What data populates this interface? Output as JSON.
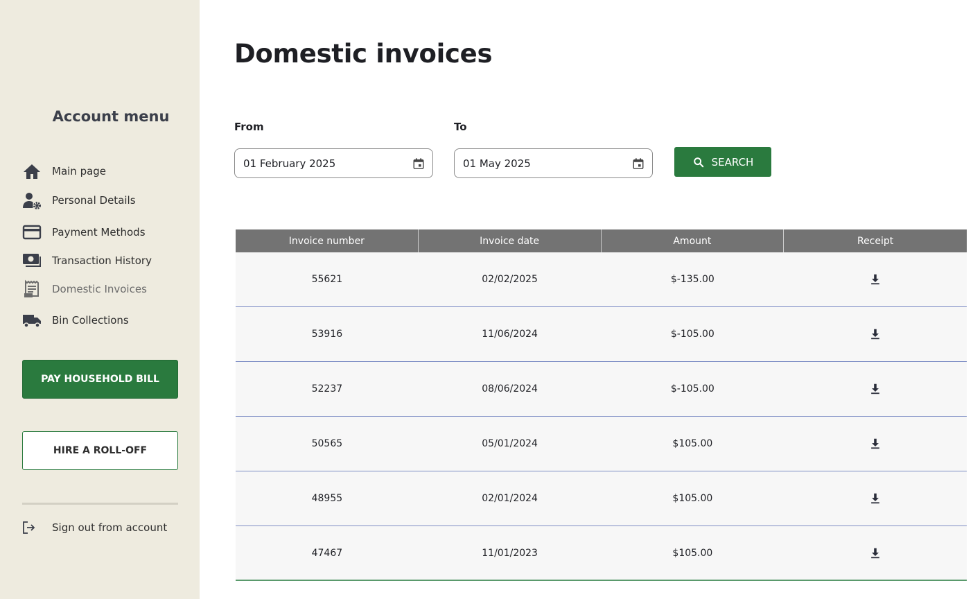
{
  "sidebar": {
    "title": "Account menu",
    "items": [
      {
        "label": "Main page",
        "icon": "home-icon"
      },
      {
        "label": "Personal Details",
        "icon": "user-settings-icon"
      },
      {
        "label": "Payment Methods",
        "icon": "credit-card-icon"
      },
      {
        "label": "Transaction History",
        "icon": "cash-icon"
      },
      {
        "label": "Domestic Invoices",
        "icon": "receipt-icon",
        "active": true
      },
      {
        "label": "Bin Collections",
        "icon": "truck-icon"
      }
    ],
    "pay_button": "PAY HOUSEHOLD BILL",
    "hire_button": "HIRE A ROLL-OFF",
    "signout": {
      "label": "Sign out from account",
      "icon": "logout-icon"
    }
  },
  "main": {
    "title": "Domestic invoices",
    "from_label": "From",
    "to_label": "To",
    "from_value": "01 February 2025",
    "to_value": "01 May 2025",
    "search_label": "SEARCH"
  },
  "table": {
    "headers": [
      "Invoice number",
      "Invoice date",
      "Amount",
      "Receipt"
    ],
    "rows": [
      {
        "number": "55621",
        "date": "02/02/2025",
        "amount": "$-135.00"
      },
      {
        "number": "53916",
        "date": "11/06/2024",
        "amount": "$-105.00"
      },
      {
        "number": "52237",
        "date": "08/06/2024",
        "amount": "$-105.00"
      },
      {
        "number": "50565",
        "date": "05/01/2024",
        "amount": "$105.00"
      },
      {
        "number": "48955",
        "date": "02/01/2024",
        "amount": "$105.00"
      },
      {
        "number": "47467",
        "date": "11/01/2023",
        "amount": "$105.00"
      }
    ]
  },
  "colors": {
    "sidebar_bg": "#eeebdf",
    "brand_green": "#2a7a3e",
    "table_header": "#737373",
    "row_divider": "#7c8cc4"
  }
}
